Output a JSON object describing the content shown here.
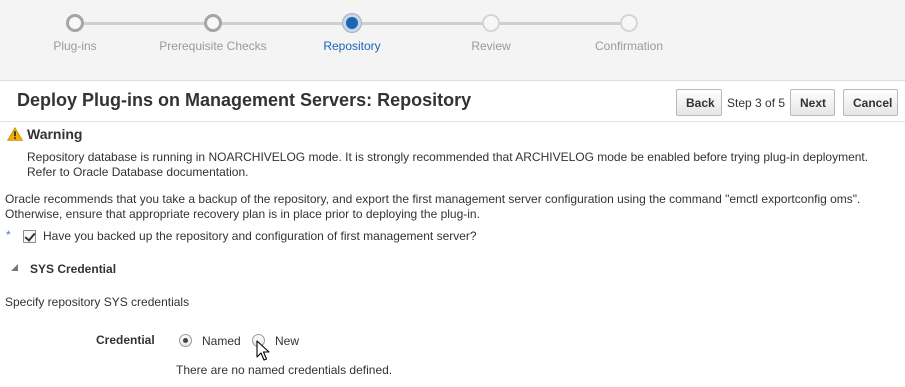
{
  "train": {
    "steps": [
      {
        "label": "Plug-ins",
        "state": "done"
      },
      {
        "label": "Prerequisite Checks",
        "state": "done"
      },
      {
        "label": "Repository",
        "state": "current"
      },
      {
        "label": "Review",
        "state": "future"
      },
      {
        "label": "Confirmation",
        "state": "future"
      }
    ],
    "colors": {
      "current": "#1a66b5",
      "line": "#cfcfcf"
    }
  },
  "header": {
    "title": "Deploy Plug-ins on Management Servers: Repository",
    "back_label": "Back",
    "step_text": "Step 3 of 5",
    "next_label": "Next",
    "cancel_label": "Cancel"
  },
  "warning": {
    "icon": "warning-triangle-icon",
    "title": "Warning",
    "line1": "Repository database is running in NOARCHIVELOG mode. It is strongly recommended that ARCHIVELOG mode be enabled before trying plug-in deployment.",
    "line2": "Refer to Oracle Database documentation."
  },
  "recommendation": {
    "line1": "Oracle recommends that you take a backup of the repository, and export the first management server configuration using the command \"emctl exportconfig oms\".",
    "line2": "Otherwise, ensure that appropriate recovery plan is in place prior to deploying the plug-in."
  },
  "backup_check": {
    "required_marker": "*",
    "label": "Have you backed up the repository and configuration of first management server?",
    "checked": true
  },
  "sys_credential": {
    "section_title": "SYS Credential",
    "description": "Specify repository SYS credentials",
    "credential_label": "Credential",
    "options": [
      {
        "label": "Named",
        "selected": true
      },
      {
        "label": "New",
        "selected": false
      }
    ],
    "no_credentials_message": "There are no named credentials defined."
  }
}
